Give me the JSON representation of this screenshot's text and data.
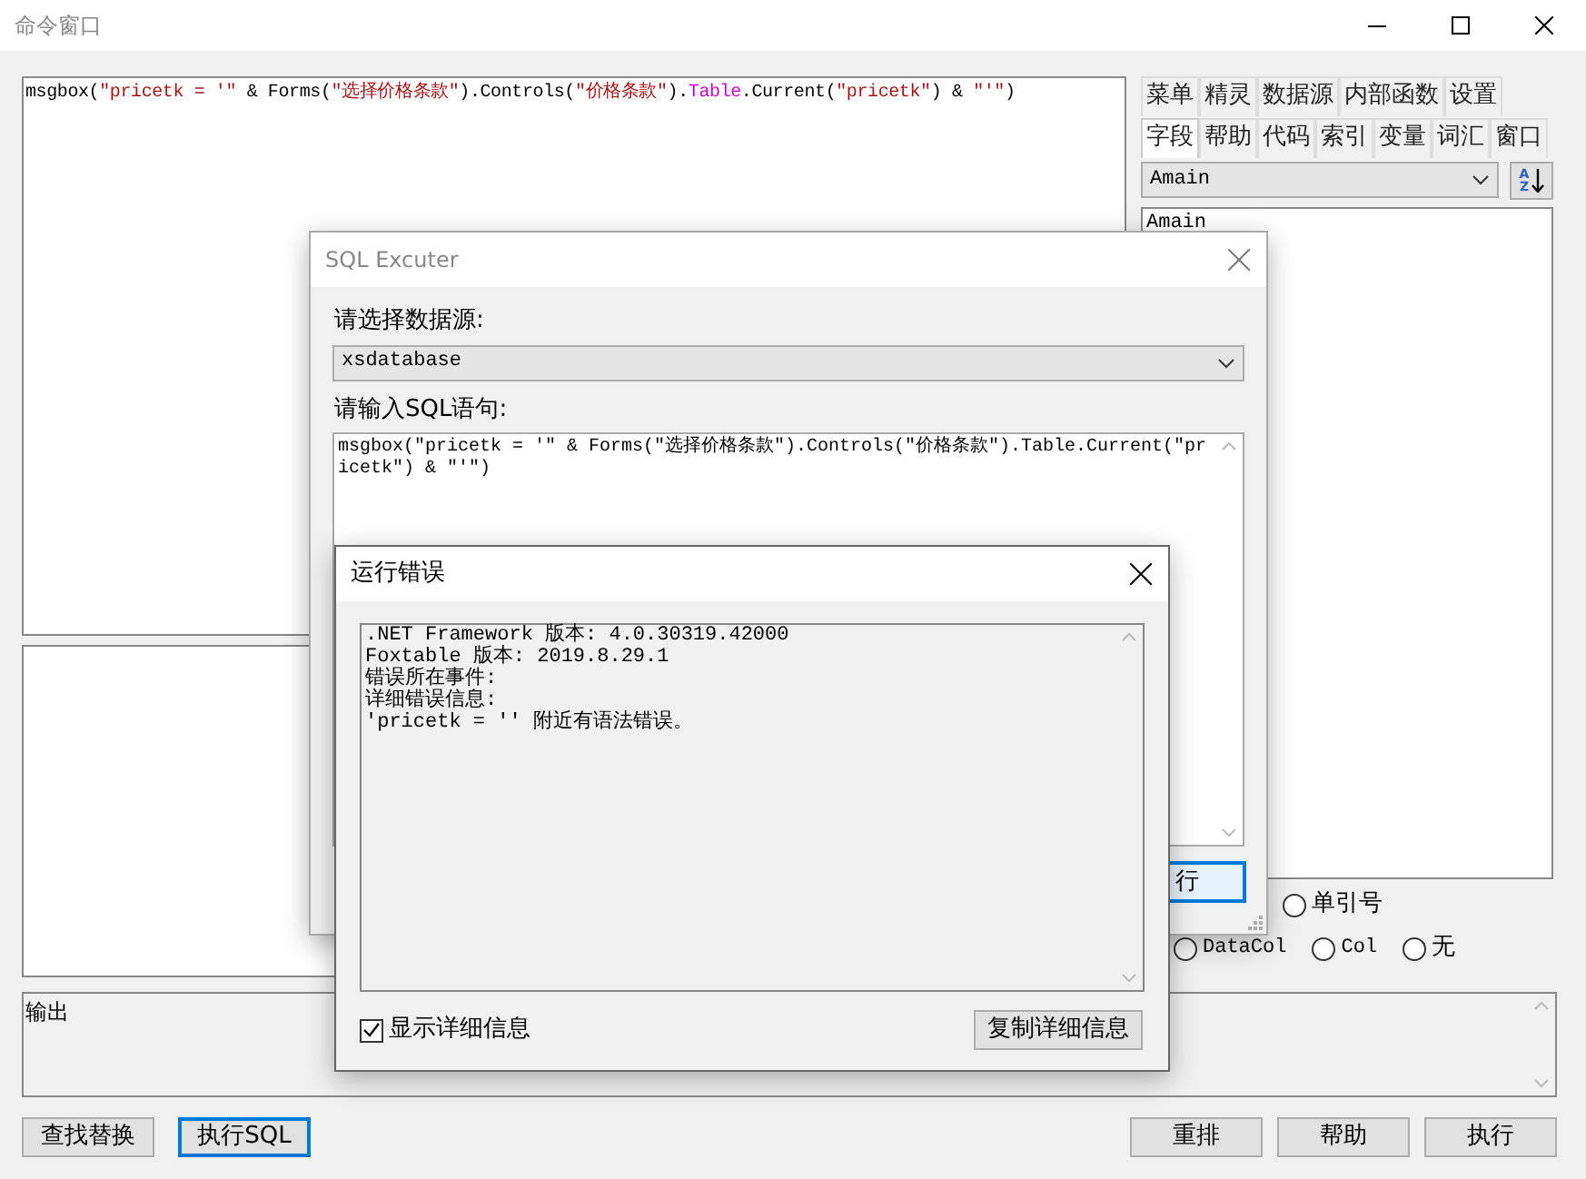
{
  "window": {
    "title": "命令窗口"
  },
  "editor": {
    "tokens": [
      {
        "text": "msgbox(",
        "kind": "plain"
      },
      {
        "text": "\"pricetk = '\"",
        "kind": "string"
      },
      {
        "text": " & Forms(",
        "kind": "plain"
      },
      {
        "text": "\"选择价格条款\"",
        "kind": "string"
      },
      {
        "text": ").Controls(",
        "kind": "plain"
      },
      {
        "text": "\"价格条款\"",
        "kind": "string"
      },
      {
        "text": ").",
        "kind": "plain"
      },
      {
        "text": "Table",
        "kind": "keyword"
      },
      {
        "text": ".Current(",
        "kind": "plain"
      },
      {
        "text": "\"pricetk\"",
        "kind": "string"
      },
      {
        "text": ") & ",
        "kind": "plain"
      },
      {
        "text": "\"'\"",
        "kind": "string"
      },
      {
        "text": ")",
        "kind": "plain"
      }
    ]
  },
  "tab_rows": [
    {
      "tabs": [
        {
          "label": "菜单",
          "selected": false
        },
        {
          "label": "精灵",
          "selected": false
        },
        {
          "label": "数据源",
          "selected": false
        },
        {
          "label": "内部函数",
          "selected": false
        },
        {
          "label": "设置",
          "selected": false
        }
      ]
    },
    {
      "tabs": [
        {
          "label": "字段",
          "selected": true
        },
        {
          "label": "帮助",
          "selected": false
        },
        {
          "label": "代码",
          "selected": false
        },
        {
          "label": "索引",
          "selected": false
        },
        {
          "label": "变量",
          "selected": false
        },
        {
          "label": "词汇",
          "selected": false
        },
        {
          "label": "窗口",
          "selected": false
        }
      ]
    }
  ],
  "table_select": {
    "value": "Amain"
  },
  "sort_button": {
    "top_letter": "A",
    "bottom_letter": "Z"
  },
  "table_list": {
    "items": [
      {
        "label": "Amain",
        "selected": false
      }
    ]
  },
  "option_rows": [
    {
      "options": [
        {
          "label": "单引号",
          "selected": false
        }
      ]
    },
    {
      "options": [
        {
          "label": "DataCol",
          "selected": false
        },
        {
          "label": "Col",
          "selected": false
        },
        {
          "label": "无",
          "selected": false
        }
      ]
    }
  ],
  "output": {
    "label": "输出"
  },
  "buttons_left": [
    {
      "label": "查找替换",
      "focused": false
    },
    {
      "label": "执行SQL",
      "focused": true
    }
  ],
  "buttons_right": [
    {
      "label": "重排",
      "focused": false
    },
    {
      "label": "帮助",
      "focused": false
    },
    {
      "label": "执行",
      "focused": false
    }
  ],
  "sql_dialog": {
    "title": "SQL Excuter",
    "source_label": "请选择数据源:",
    "source_value": "xsdatabase",
    "sql_label": "请输入SQL语句:",
    "sql_text": "msgbox(\"pricetk = '\" & Forms(\"选择价格条款\").Controls(\"价格条款\").Table.Current(\"pricetk\") & \"'\")",
    "run_button": {
      "label": "行",
      "focused": true
    }
  },
  "error_dialog": {
    "title": "运行错误",
    "details": [
      ".NET Framework 版本: 4.0.30319.42000",
      "Foxtable 版本: 2019.8.29.1",
      "错误所在事件:",
      "详细错误信息:",
      "'pricetk = '' 附近有语法错误。"
    ],
    "show_details": {
      "label": "显示详细信息",
      "checked": true
    },
    "copy_button": "复制详细信息"
  }
}
